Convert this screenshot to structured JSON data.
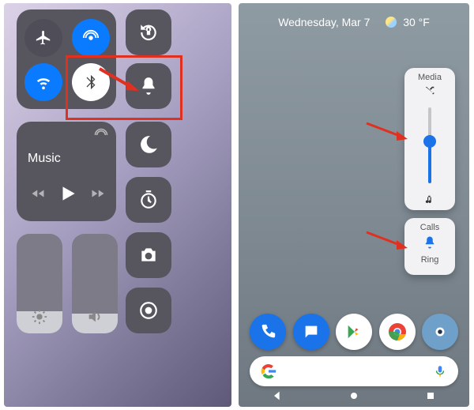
{
  "ios": {
    "connectivity": {
      "airplane": "airplane-icon",
      "airdrop": "airdrop-icon",
      "wifi": "wifi-icon",
      "bluetooth": "bluetooth-icon"
    },
    "orientation_lock": "rotation-lock-icon",
    "bell": "bell-icon",
    "do_not_disturb": "moon-icon",
    "timer": "timer-icon",
    "camera": "camera-icon",
    "record": "record-icon",
    "music": {
      "label": "Music",
      "prev": "rewind-icon",
      "play": "play-icon",
      "next": "forward-icon"
    },
    "brightness": {
      "level_pct": 22,
      "icon": "brightness-icon"
    },
    "volume": {
      "level_pct": 20,
      "icon": "speaker-icon"
    }
  },
  "android": {
    "status": {
      "date": "Wednesday, Mar 7",
      "temp": "30 °F"
    },
    "media_panel": {
      "title": "Media",
      "top_icon": "shuffle-icon",
      "bottom_icon": "note-icon",
      "level_pct": 55
    },
    "calls_panel": {
      "title": "Calls",
      "icon": "bell-icon",
      "label": "Ring"
    },
    "dock": {
      "phone": "phone-icon",
      "messages": "messages-icon",
      "play_store": "play-store-icon",
      "chrome": "chrome-icon",
      "camera": "camera-icon"
    },
    "search": {
      "logo": "google-logo",
      "mic": "mic-icon"
    },
    "nav": {
      "back": "back-icon",
      "home": "home-icon",
      "recent": "recent-icon"
    }
  }
}
